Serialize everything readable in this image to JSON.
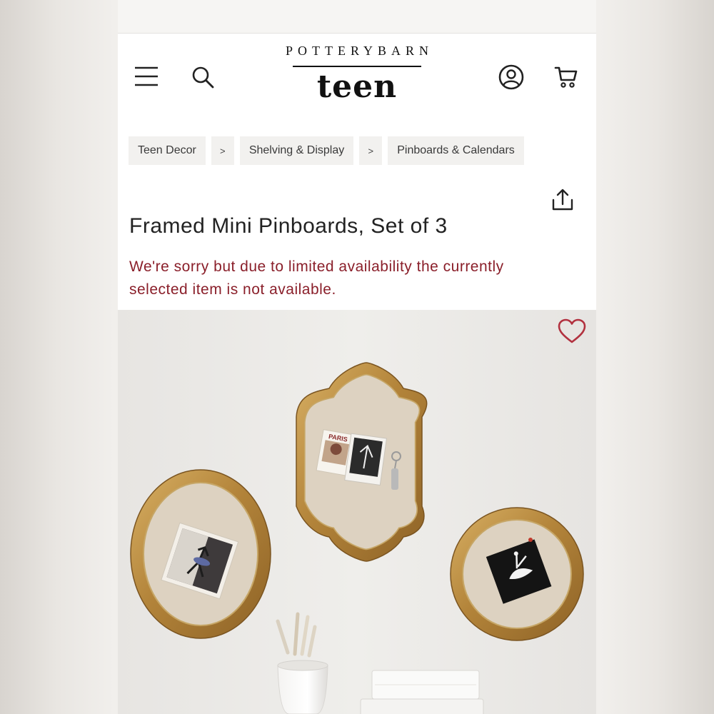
{
  "header": {
    "brand_top": "POTTERYBARN",
    "brand_sub": "teen",
    "menu_icon": "hamburger-menu-icon",
    "search_icon": "search-icon",
    "account_icon": "account-icon",
    "cart_icon": "cart-icon"
  },
  "breadcrumb": [
    {
      "label": "Teen Decor"
    },
    {
      "label": "Shelving & Display"
    },
    {
      "label": "Pinboards & Calendars"
    }
  ],
  "breadcrumb_separator": ">",
  "product": {
    "title": "Framed Mini Pinboards, Set of 3",
    "availability_notice": "We're sorry but due to limited availability the currently selected item is not available.",
    "share_icon": "share-icon",
    "favorite_icon": "heart-icon",
    "photo_labels": [
      "PARIS"
    ]
  },
  "colors": {
    "notice": "#8a1f2a",
    "heart": "#b2313f",
    "frame_gold": "#b98a3b",
    "board_linen": "#ddd2c1"
  }
}
